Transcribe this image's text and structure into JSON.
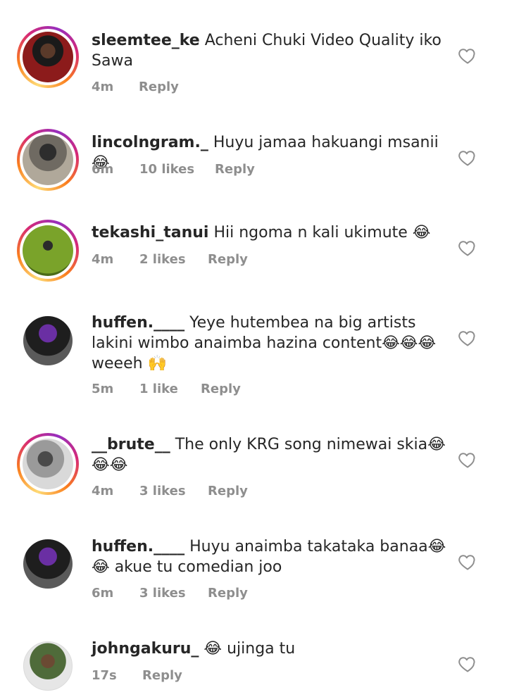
{
  "comments": [
    {
      "username": "sleemtee_ke",
      "text": "Acheni Chuki Video Quality iko Sawa",
      "time": "4m",
      "likes": "",
      "reply": "Reply",
      "has_story_ring": true,
      "avatar_colors": [
        "#1a1a1a",
        "#8c1b1b"
      ]
    },
    {
      "username": "lincolngram._",
      "text": "Huyu jamaa hakuangi msanii😂",
      "time": "6m",
      "likes": "10 likes",
      "reply": "Reply",
      "has_story_ring": true,
      "avatar_colors": [
        "#3b3b3b",
        "#b0a89a"
      ]
    },
    {
      "username": "tekashi_tanui",
      "text": "Hii ngoma n kali ukimute 😂",
      "time": "4m",
      "likes": "2 likes",
      "reply": "Reply",
      "has_story_ring": true,
      "avatar_colors": [
        "#7aa32a",
        "#4a6b17"
      ]
    },
    {
      "username": "huffen.____",
      "text": "Yeye hutembea na big artists lakini wimbo anaimba hazina content😂😂😂weeeh 🙌",
      "time": "5m",
      "likes": "1 like",
      "reply": "Reply",
      "has_story_ring": false,
      "avatar_colors": [
        "#121212",
        "#6a2fa3"
      ]
    },
    {
      "username": "__brute__",
      "text": "The only KRG song nimewai skia😂 😂😂",
      "time": "4m",
      "likes": "3 likes",
      "reply": "Reply",
      "has_story_ring": true,
      "avatar_colors": [
        "#d9d9d9",
        "#3a3a3a"
      ]
    },
    {
      "username": "huffen.____",
      "text": "Huyu anaimba takataka banaa😂 😂 akue tu comedian joo",
      "time": "6m",
      "likes": "3 likes",
      "reply": "Reply",
      "has_story_ring": false,
      "avatar_colors": [
        "#121212",
        "#6a2fa3"
      ]
    },
    {
      "username": "johngakuru_",
      "text": "😂 ujinga tu",
      "time": "17s",
      "likes": "",
      "reply": "Reply",
      "has_story_ring": false,
      "avatar_colors": [
        "#e6e6e6",
        "#4f6b3a"
      ]
    }
  ],
  "icons": {
    "like": "heart-outline-icon"
  },
  "colors": {
    "meta_text": "#8e8e8e",
    "text": "#262626"
  }
}
